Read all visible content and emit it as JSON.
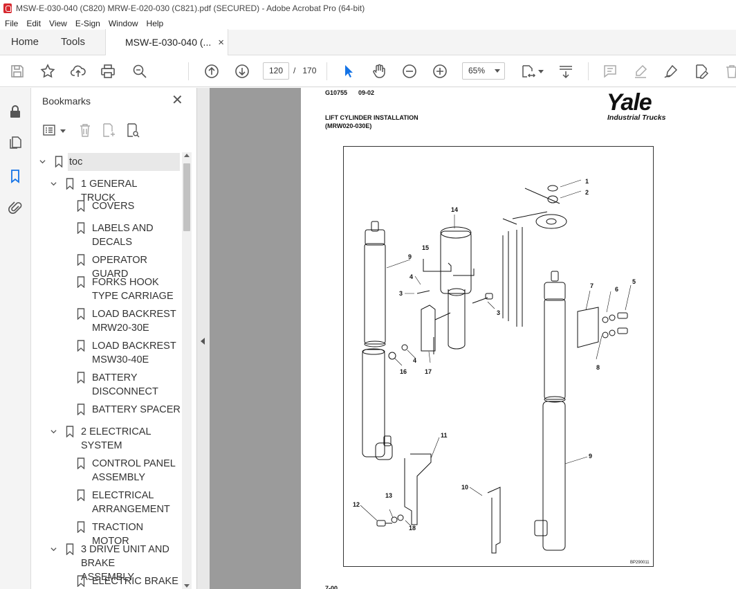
{
  "window": {
    "title": "MSW-E-030-040 (C820) MRW-E-020-030 (C821).pdf (SECURED) - Adobe Acrobat Pro (64-bit)"
  },
  "menu": [
    "File",
    "Edit",
    "View",
    "E-Sign",
    "Window",
    "Help"
  ],
  "tabs": {
    "home": "Home",
    "tools": "Tools",
    "document": "MSW-E-030-040 (...",
    "close_glyph": "×"
  },
  "toolbar": {
    "current_page": "120",
    "page_separator": "/",
    "total_pages": "170",
    "zoom": "65%"
  },
  "bookmarks": {
    "title": "Bookmarks",
    "close_glyph": "✕",
    "items": [
      {
        "label": "toc",
        "level": 0,
        "expanded": true,
        "selected": true
      },
      {
        "label": "1 GENERAL TRUCK",
        "level": 1,
        "expanded": true
      },
      {
        "label": "COVERS",
        "level": 2
      },
      {
        "label": "LABELS AND DECALS",
        "level": 2
      },
      {
        "label": "OPERATOR GUARD",
        "level": 2
      },
      {
        "label": "FORKS HOOK TYPE CARRIAGE",
        "level": 2
      },
      {
        "label": "LOAD BACKREST MRW20-30E",
        "level": 2
      },
      {
        "label": "LOAD BACKREST MSW30-40E",
        "level": 2
      },
      {
        "label": "BATTERY DISCONNECT",
        "level": 2
      },
      {
        "label": "BATTERY SPACER",
        "level": 2
      },
      {
        "label": "2 ELECTRICAL SYSTEM",
        "level": 1,
        "expanded": true
      },
      {
        "label": "CONTROL PANEL ASSEMBLY",
        "level": 2
      },
      {
        "label": "ELECTRICAL ARRANGEMENT",
        "level": 2
      },
      {
        "label": "TRACTION MOTOR",
        "level": 2
      },
      {
        "label": "3 DRIVE UNIT AND BRAKE ASSEMBLY",
        "level": 1,
        "expanded": true
      },
      {
        "label": "ELECTRIC BRAKE",
        "level": 2
      }
    ]
  },
  "page": {
    "code": "G10755",
    "date": "09-02",
    "title_line1": "LIFT CYLINDER INSTALLATION",
    "title_line2": "(MRW020-030E)",
    "logo": "Yale",
    "logo_sub": "Industrial Trucks",
    "figure_ref": "BP290011",
    "footer": "7-00",
    "callouts": [
      "1",
      "2",
      "14",
      "15",
      "9",
      "4",
      "3",
      "3",
      "7",
      "6",
      "5",
      "16",
      "4",
      "17",
      "8",
      "11",
      "9",
      "10",
      "12",
      "13",
      "18"
    ]
  }
}
